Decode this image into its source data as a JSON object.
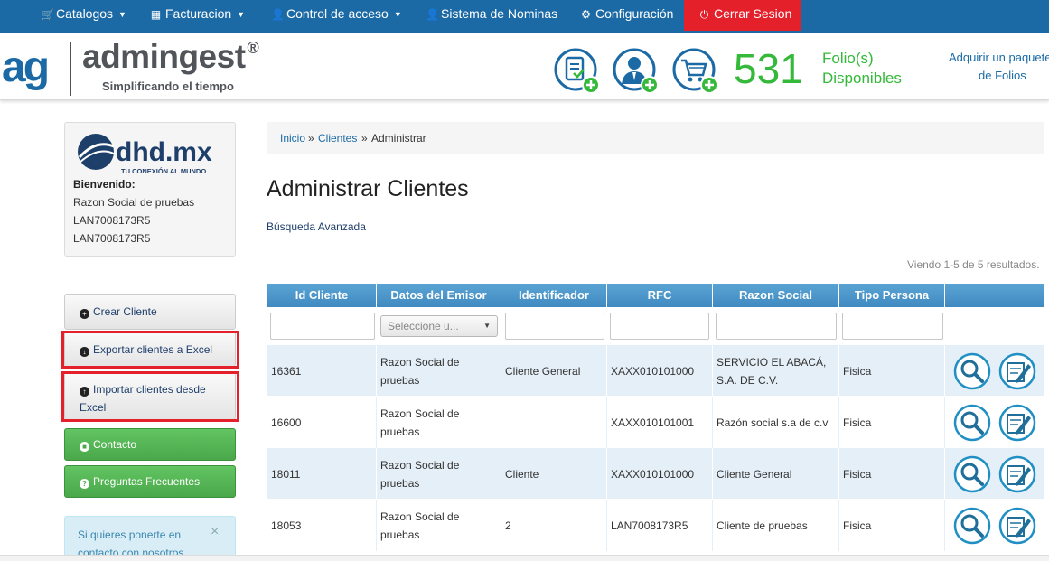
{
  "nav": {
    "items": [
      {
        "label": "Catalogos",
        "icon": "cart-icon",
        "glyph": "🛒",
        "caret": true
      },
      {
        "label": "Facturacion",
        "icon": "qrcode-icon",
        "glyph": "▦",
        "caret": true
      },
      {
        "label": "Control de acceso",
        "icon": "user-icon",
        "glyph": "👤",
        "caret": true
      },
      {
        "label": "Sistema de Nominas",
        "icon": "user-icon",
        "glyph": "👤",
        "caret": false
      },
      {
        "label": "Configuración",
        "icon": "gear-icon",
        "glyph": "⚙",
        "caret": false
      }
    ],
    "logout": {
      "label": "Cerrar Sesion",
      "icon": "power-icon",
      "glyph": "⏻"
    }
  },
  "header": {
    "brand": "admingest",
    "registered": "®",
    "tagline": "Simplificando el tiempo",
    "folio_count": "531",
    "folio_label_1": "Folio(s)",
    "folio_label_2": "Disponibles",
    "buy_line_1": "Adquirir un paquete",
    "buy_line_2": "de Folios",
    "icons": [
      "new-invoice-icon",
      "add-user-icon",
      "add-to-cart-icon"
    ]
  },
  "profile": {
    "logo_text": "dhd.mx",
    "logo_tagline": "TU CONEXIÓN AL MUNDO",
    "welcome": "Bienvenido:",
    "lines": [
      "Razon Social de pruebas",
      "LAN7008173R5",
      "LAN7008173R5"
    ]
  },
  "sidebar": {
    "buttons": [
      {
        "label": "Crear Cliente",
        "style": "gray",
        "icon": "plus-circle-icon",
        "glyph": "+",
        "highlight": false
      },
      {
        "label": "Exportar clientes a Excel",
        "style": "gray",
        "icon": "download-circle-icon",
        "glyph": "↓",
        "highlight": true
      },
      {
        "label": "Importar clientes desde Excel",
        "style": "gray",
        "icon": "upload-circle-icon",
        "glyph": "↑",
        "highlight": true
      },
      {
        "label": "Contacto",
        "style": "green",
        "icon": "chat-icon",
        "glyph": "■",
        "highlight": false
      },
      {
        "label": "Preguntas Frecuentes",
        "style": "green",
        "icon": "question-circle-icon",
        "glyph": "?",
        "highlight": false
      }
    ],
    "info_text": "Si quieres ponerte en contacto con nosotros,",
    "info_close": "×"
  },
  "main": {
    "breadcrumb": [
      {
        "label": "Inicio",
        "link": true
      },
      {
        "label": "Clientes",
        "link": true
      },
      {
        "label": "Administrar",
        "link": false
      }
    ],
    "breadcrumb_sep": "»",
    "title": "Administrar Clientes",
    "advanced_search": "Búsqueda Avanzada",
    "summary": "Viendo 1-5 de 5 resultados."
  },
  "table": {
    "columns": [
      "Id Cliente",
      "Datos del Emisor",
      "Identificador",
      "RFC",
      "Razon Social",
      "Tipo Persona",
      ""
    ],
    "select_placeholder": "Seleccione u...",
    "rows": [
      {
        "id": "16361",
        "emisor": "Razon Social de pruebas",
        "identificador": "Cliente General",
        "rfc": "XAXX010101000",
        "razon": "SERVICIO EL ABACÁ, S.A. DE C.V.",
        "tipo": "Fisica"
      },
      {
        "id": "16600",
        "emisor": "Razon Social de pruebas",
        "identificador": "",
        "rfc": "XAXX010101001",
        "razon": "Razón social s.a de c.v",
        "tipo": "Fisica"
      },
      {
        "id": "18011",
        "emisor": "Razon Social de pruebas",
        "identificador": "Cliente",
        "rfc": "XAXX010101000",
        "razon": "Cliente General",
        "tipo": "Fisica"
      },
      {
        "id": "18053",
        "emisor": "Razon Social de pruebas",
        "identificador": "2",
        "rfc": "LAN7008173R5",
        "razon": "Cliente de pruebas",
        "tipo": "Fisica"
      }
    ],
    "action_icons": [
      "view-icon",
      "edit-icon"
    ]
  },
  "colors": {
    "nav_bg": "#1b6aa5",
    "logout_bg": "#e4202a",
    "folio_green": "#35b93a",
    "table_header": "#4a94c8",
    "row_alt": "#e4eff7"
  }
}
